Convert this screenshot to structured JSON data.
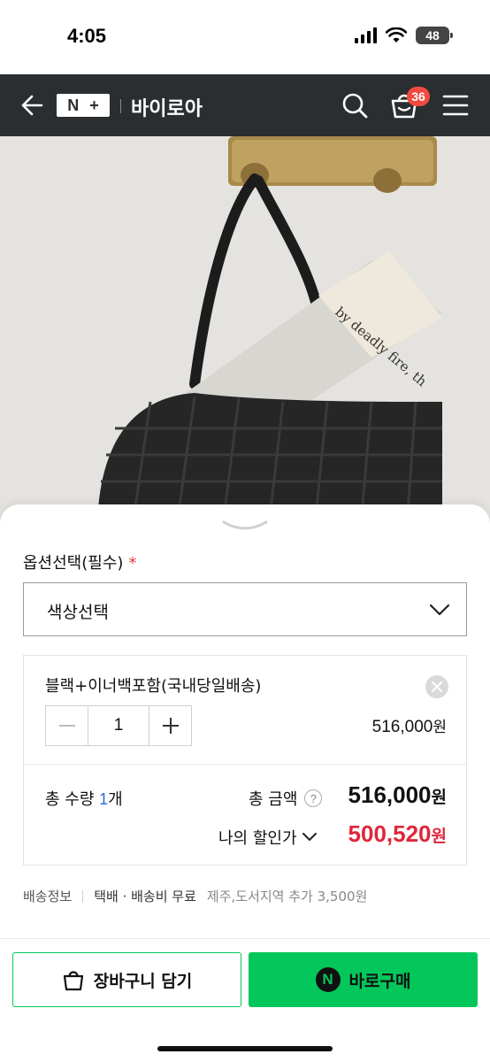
{
  "status_bar": {
    "time": "4:05",
    "battery": "48"
  },
  "header": {
    "logo_text": "N+",
    "store_name": "바이로아",
    "cart_count": "36"
  },
  "options": {
    "title": "옵션선택(필수)",
    "required_mark": "*",
    "select_label": "색상선택"
  },
  "selected_item": {
    "name": "블랙+이너백포함(국내당일배송)",
    "quantity": "1",
    "price": "516,000",
    "currency": "원"
  },
  "summary": {
    "qty_prefix": "총 수량 ",
    "qty_value": "1",
    "qty_unit": "개",
    "total_label": "총 금액",
    "help": "?",
    "total_amount": "516,000",
    "discount_label": "나의 할인가",
    "discount_amount": "500,520",
    "currency": "원"
  },
  "shipping": {
    "label": "배송정보",
    "method": "택배 · 배송비 무료",
    "extra": "제주,도서지역 추가 3,500원"
  },
  "buttons": {
    "cart": "장바구니 담기",
    "buy": "바로구매",
    "npay_mark": "N"
  },
  "colors": {
    "brand_green": "#03c75a",
    "discount_red": "#e0263b",
    "header_bg": "#2b2e30",
    "badge": "#f24a3f"
  }
}
